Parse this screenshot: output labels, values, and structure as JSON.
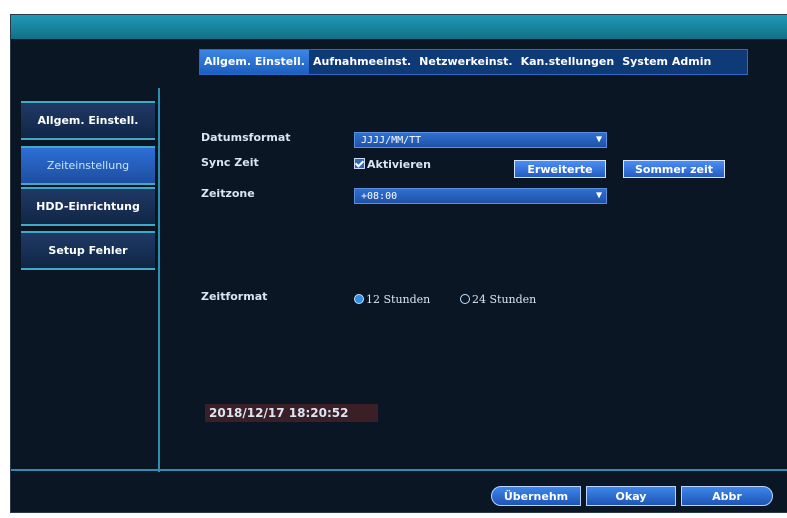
{
  "top_tabs": [
    {
      "label": "Allgem. Einstell."
    },
    {
      "label": "Aufnahmeeinst."
    },
    {
      "label": "Netzwerkeinst."
    },
    {
      "label": "Kan.stellungen"
    },
    {
      "label": "System Admin"
    }
  ],
  "sidebar": {
    "items": [
      {
        "label": "Allgem. Einstell."
      },
      {
        "label": "Zeiteinstellung"
      },
      {
        "label": "HDD-Einrichtung"
      },
      {
        "label": "Setup Fehler"
      }
    ],
    "selected_index": 1
  },
  "form": {
    "date_format_label": "Datumsformat",
    "date_format_value": "JJJJ/MM/TT",
    "sync_time_label": "Sync Zeit",
    "sync_time_checkbox_label": "Aktivieren",
    "advanced_button": "Erweiterte",
    "summer_time_button": "Sommer zeit",
    "time_zone_label": "Zeitzone",
    "time_zone_value": "+08:00",
    "time_format_label": "Zeitformat",
    "radio_12_label": "12 Stunden",
    "radio_24_label": "24 Stunden",
    "current_datetime": "2018/12/17 18:20:52"
  },
  "footer": {
    "apply_button": "Übernehm",
    "ok_button": "Okay",
    "cancel_button": "Abbr"
  },
  "colors": {
    "background": "#0b1624",
    "accent": "#2c69c5",
    "topbar": "#1f9bb8"
  }
}
